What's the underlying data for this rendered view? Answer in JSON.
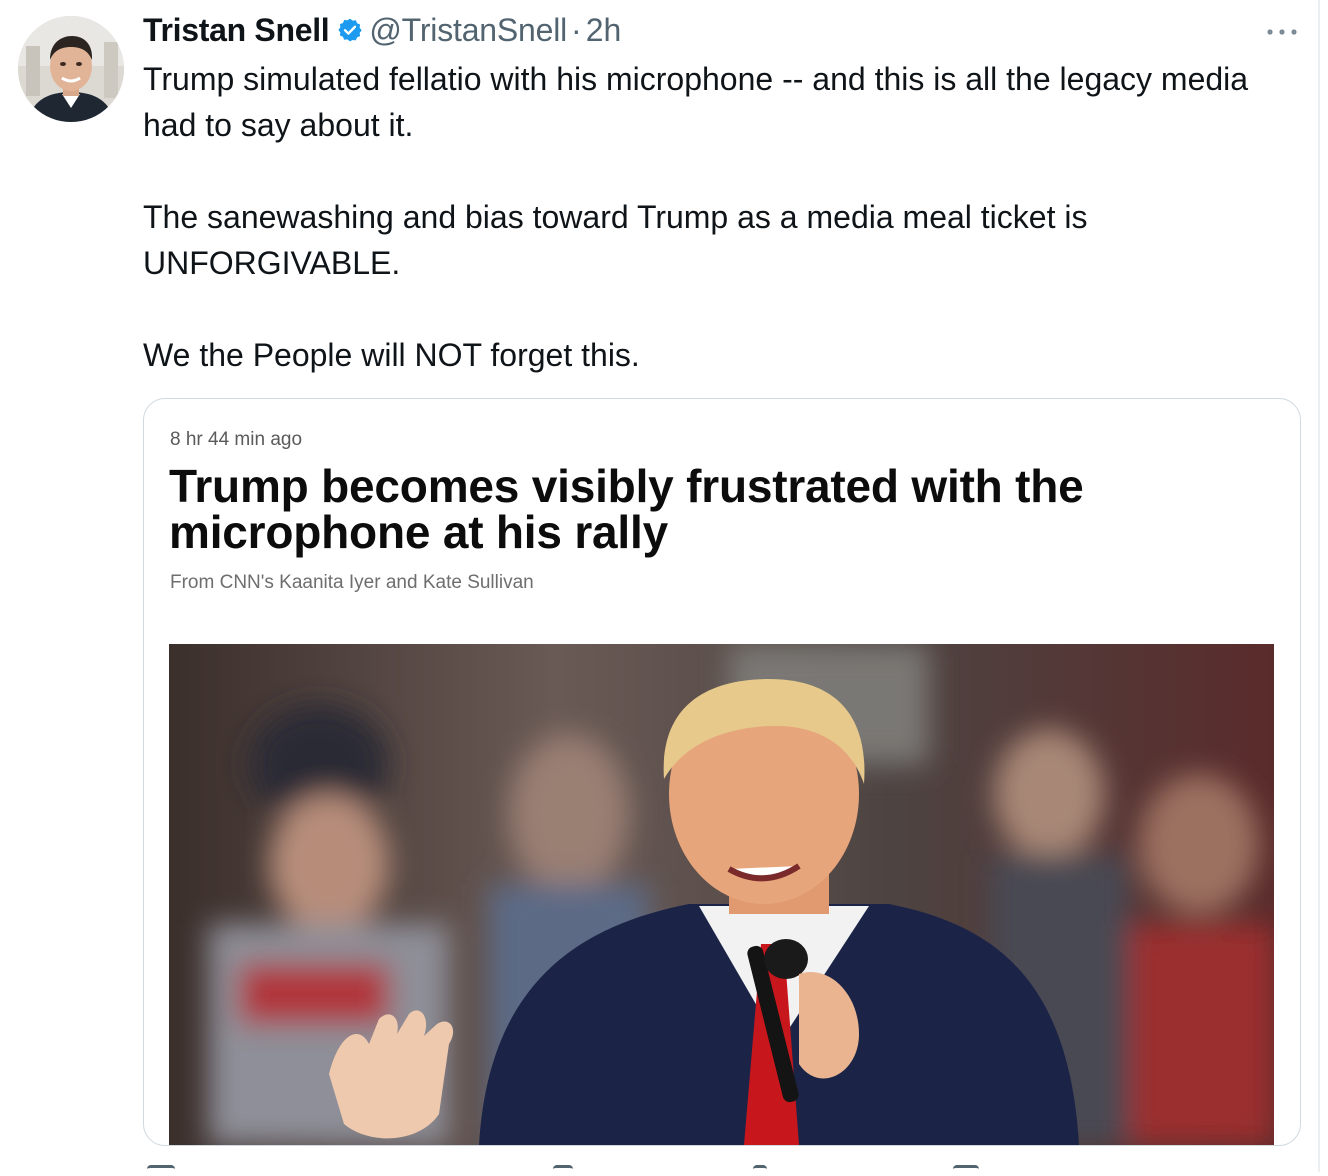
{
  "tweet": {
    "author_name": "Tristan Snell",
    "handle": "@TristanSnell",
    "separator": "·",
    "time": "2h",
    "paragraphs": [
      "Trump simulated fellatio with his microphone -- and this is all the legacy media had to say about it.",
      "The sanewashing and bias toward Trump as a media meal ticket is UNFORGIVABLE.",
      "We the People will NOT forget this."
    ]
  },
  "card": {
    "timestamp": "8 hr 44 min ago",
    "headline": "Trump becomes visibly frustrated with the microphone at his rally",
    "byline": "From CNN's Kaanita Iyer and Kate Sullivan"
  },
  "icons": {
    "verified": "verified-badge-icon",
    "more": "more-options-icon"
  },
  "colors": {
    "text": "#0f1419",
    "secondary": "#536471",
    "verified": "#1d9bf0",
    "card_border": "#cfd9de"
  }
}
